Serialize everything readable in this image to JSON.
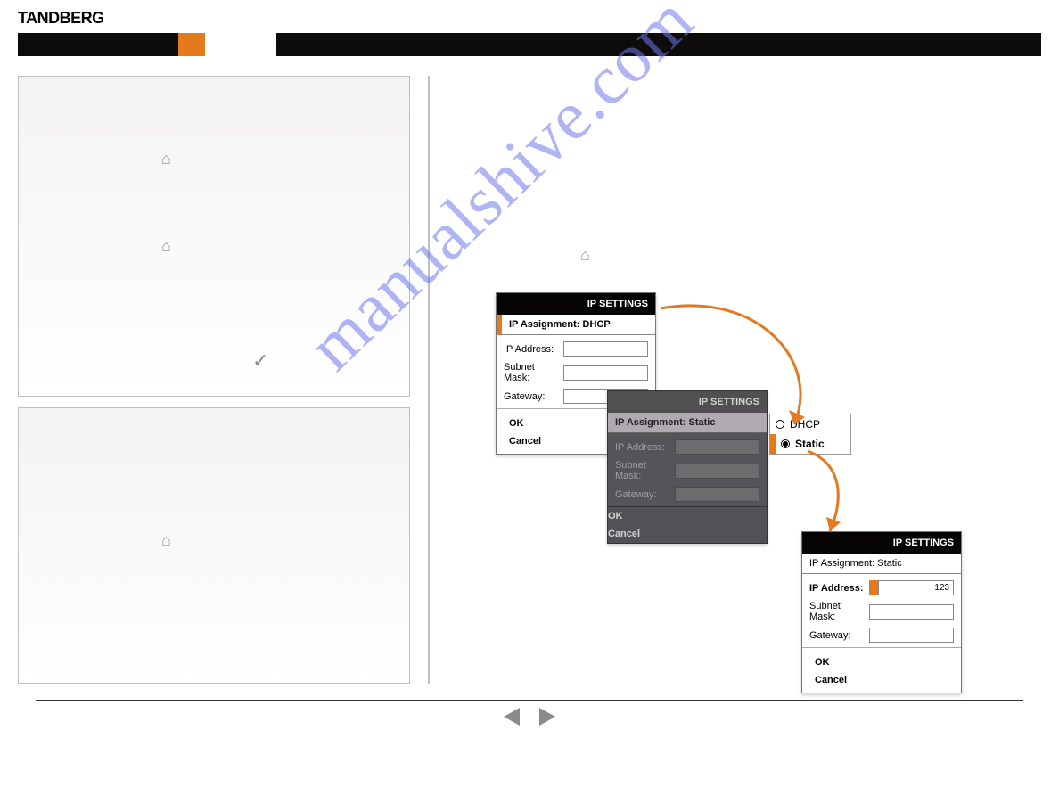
{
  "brand": "TANDBERG",
  "watermark": "manualshive.com",
  "dlg1": {
    "title": "IP SETTINGS",
    "assignment_label": "IP Assignment:",
    "assignment_value": "DHCP",
    "ip_label": "IP Address:",
    "mask_label": "Subnet Mask:",
    "gw_label": "Gateway:",
    "ok": "OK",
    "cancel": "Cancel"
  },
  "dlg2": {
    "title": "IP SETTINGS",
    "assignment_label_full": "IP Assignment: Static",
    "ip_label": "IP Address:",
    "mask_label": "Subnet Mask:",
    "gw_label": "Gateway:",
    "ok": "OK",
    "cancel": "Cancel"
  },
  "opt": {
    "dhcp": "DHCP",
    "static": "Static"
  },
  "dlg3": {
    "title": "IP SETTINGS",
    "assignment_label_full": "IP Assignment: Static",
    "ip_label": "IP Address:",
    "ip_value": "123",
    "mask_label": "Subnet Mask:",
    "gw_label": "Gateway:",
    "ok": "OK",
    "cancel": "Cancel"
  }
}
